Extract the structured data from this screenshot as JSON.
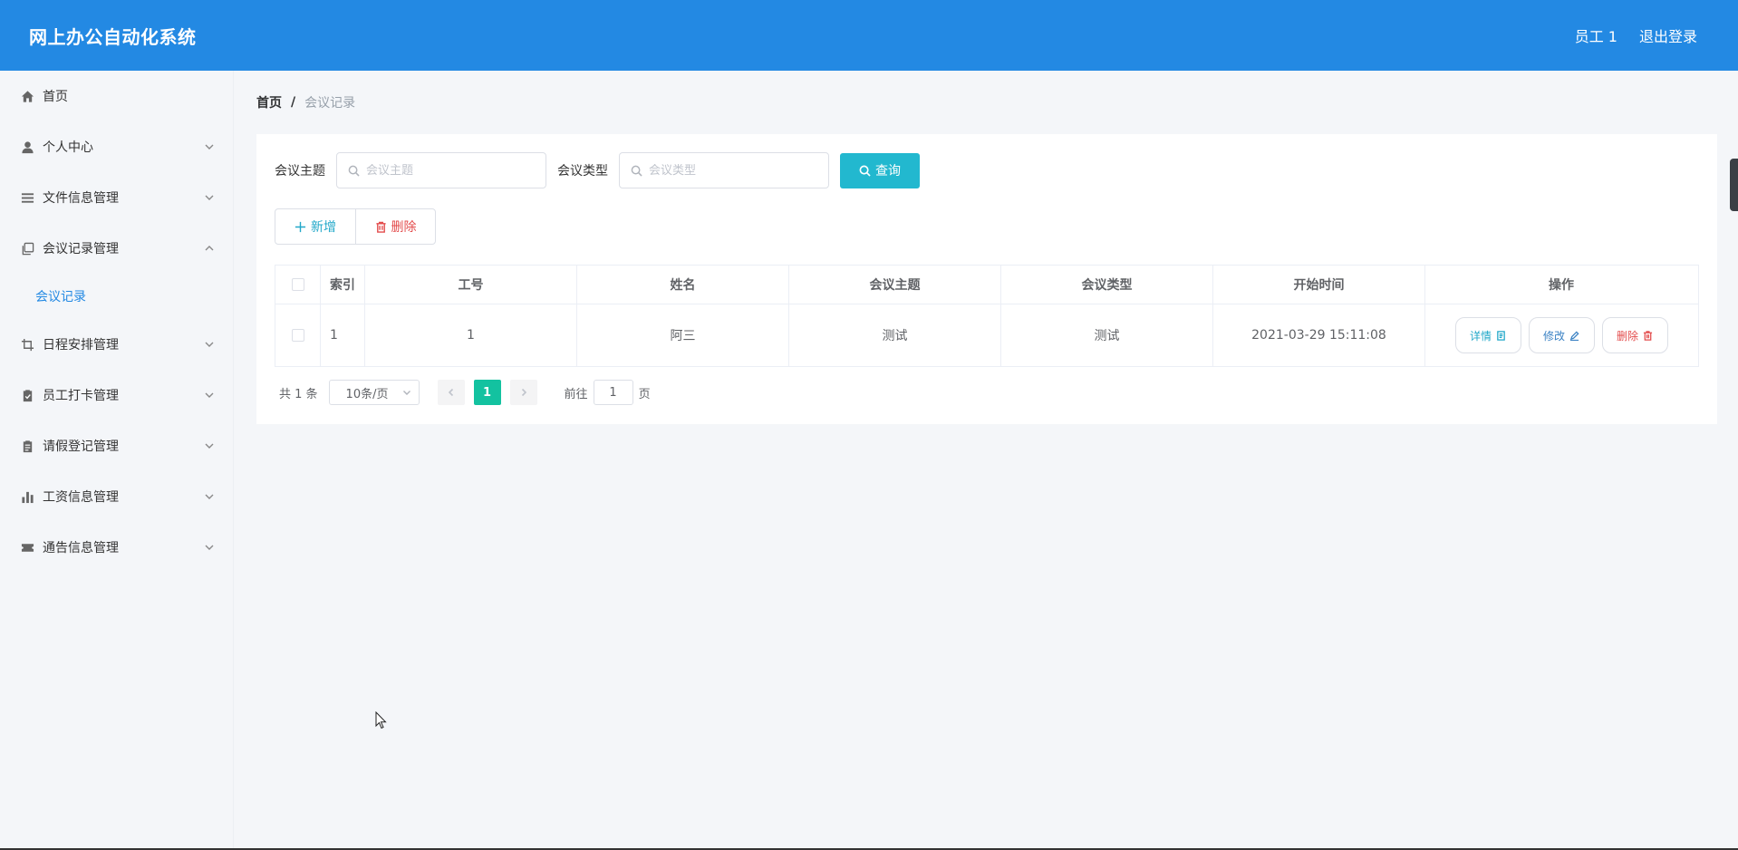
{
  "header": {
    "title": "网上办公自动化系统",
    "user": "员工 1",
    "logout": "退出登录"
  },
  "sidebar": {
    "items": [
      {
        "label": "首页",
        "icon": "home-icon"
      },
      {
        "label": "个人中心",
        "icon": "user-icon"
      },
      {
        "label": "文件信息管理",
        "icon": "list-icon"
      },
      {
        "label": "会议记录管理",
        "icon": "copy-icon"
      },
      {
        "label": "日程安排管理",
        "icon": "crop-icon"
      },
      {
        "label": "员工打卡管理",
        "icon": "clipboard-check-icon"
      },
      {
        "label": "请假登记管理",
        "icon": "clipboard-icon"
      },
      {
        "label": "工资信息管理",
        "icon": "bar-chart-icon"
      },
      {
        "label": "通告信息管理",
        "icon": "ticket-icon"
      }
    ],
    "sub_item": "会议记录"
  },
  "breadcrumb": {
    "home": "首页",
    "separator": "/",
    "current": "会议记录"
  },
  "search": {
    "topic_label": "会议主题",
    "topic_placeholder": "会议主题",
    "type_label": "会议类型",
    "type_placeholder": "会议类型",
    "query_label": "查询"
  },
  "actions": {
    "add_label": "新增",
    "delete_label": "删除"
  },
  "table": {
    "columns": [
      "索引",
      "工号",
      "姓名",
      "会议主题",
      "会议类型",
      "开始时间",
      "操作"
    ],
    "rows": [
      {
        "index": "1",
        "emp_no": "1",
        "name": "阿三",
        "topic": "测试",
        "type": "测试",
        "start_time": "2021-03-29 15:11:08"
      }
    ],
    "ops": {
      "detail": "详情",
      "edit": "修改",
      "delete": "删除"
    }
  },
  "pagination": {
    "total": "共 1 条",
    "page_size": "10条/页",
    "current_page": "1",
    "goto_prefix": "前往",
    "goto_value": "1",
    "goto_suffix": "页"
  },
  "colors": {
    "header_bg": "#2389e3",
    "accent": "#22b8cf",
    "active_page": "#13c2a0",
    "danger": "#e34c4c"
  }
}
